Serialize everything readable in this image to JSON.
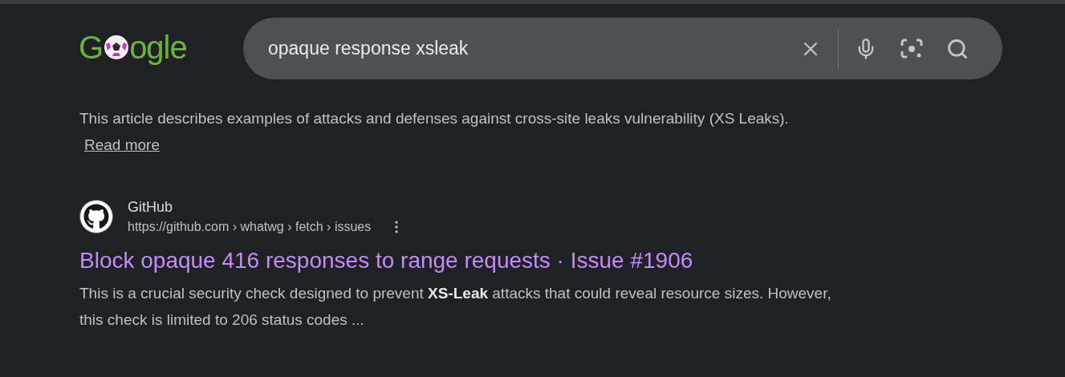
{
  "logo": {
    "text_before": "G",
    "text_after": "ogle"
  },
  "search": {
    "value": "opaque response xsleak"
  },
  "results": [
    {
      "kind": "partial",
      "snippet": "This article describes examples of attacks and defenses against cross-site leaks vulnerability (XS Leaks).",
      "read_more": "Read more"
    },
    {
      "kind": "full",
      "site": "GitHub",
      "url": "https://github.com › whatwg › fetch › issues",
      "title": "Block opaque 416 responses to range requests · Issue #1906",
      "visited": true,
      "snippet": "This is a crucial security check designed to prevent **XS-Leak** attacks that could reveal resource sizes. However, this check is limited to 206 status codes ..."
    }
  ]
}
